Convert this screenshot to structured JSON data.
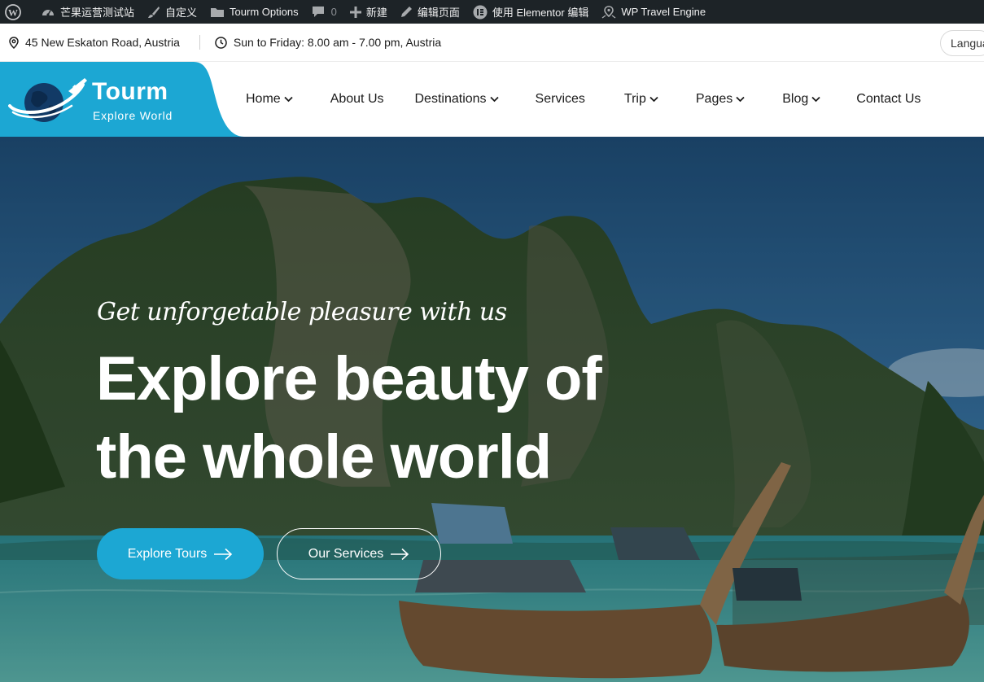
{
  "admin_bar": {
    "site_name": "芒果运营测试站",
    "customize": "自定义",
    "options": "Tourm Options",
    "comments_count": "0",
    "new": "新建",
    "edit_page": "编辑页面",
    "elementor": "使用 Elementor 编辑",
    "travel_engine": "WP Travel Engine"
  },
  "info_bar": {
    "address": "45 New Eskaton Road, Austria",
    "hours": "Sun to Friday: 8.00 am - 7.00 pm, Austria",
    "language": "Language"
  },
  "logo": {
    "title": "Tourm",
    "subtitle": "Explore World"
  },
  "nav": {
    "items": [
      {
        "label": "Home",
        "has_dropdown": true
      },
      {
        "label": "About Us",
        "has_dropdown": false
      },
      {
        "label": "Destinations",
        "has_dropdown": true
      },
      {
        "label": "Services",
        "has_dropdown": false
      },
      {
        "label": "Trip",
        "has_dropdown": true
      },
      {
        "label": "Pages",
        "has_dropdown": true
      },
      {
        "label": "Blog",
        "has_dropdown": true
      },
      {
        "label": "Contact Us",
        "has_dropdown": false
      }
    ]
  },
  "hero": {
    "tagline": "Get unforgetable pleasure with us",
    "headline_line1": "Explore beauty of",
    "headline_line2": "the whole world",
    "primary_button": "Explore Tours",
    "secondary_button": "Our Services"
  },
  "colors": {
    "accent": "#1ca7d3",
    "admin_bar": "#1d2327"
  }
}
